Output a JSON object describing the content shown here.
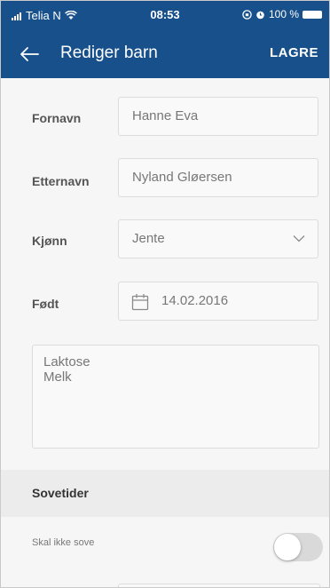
{
  "status_bar": {
    "carrier": "Telia N",
    "time": "08:53",
    "battery": "100 %"
  },
  "app_bar": {
    "title": "Rediger barn",
    "save_label": "LAGRE"
  },
  "form": {
    "first_name": {
      "label": "Fornavn",
      "value": "Hanne Eva"
    },
    "last_name": {
      "label": "Etternavn",
      "value": "Nyland Gløersen"
    },
    "gender": {
      "label": "Kjønn",
      "value": "Jente"
    },
    "born": {
      "label": "Født",
      "value": "14.02.2016"
    },
    "notes": [
      "Laktose",
      "Melk"
    ]
  },
  "sleep_section": {
    "title": "Sovetider",
    "toggle_label": "Skal ikke sove",
    "toggle_on": false
  },
  "colors": {
    "primary": "#17508a",
    "background": "#f6f6f6",
    "section_header": "#ececec"
  }
}
